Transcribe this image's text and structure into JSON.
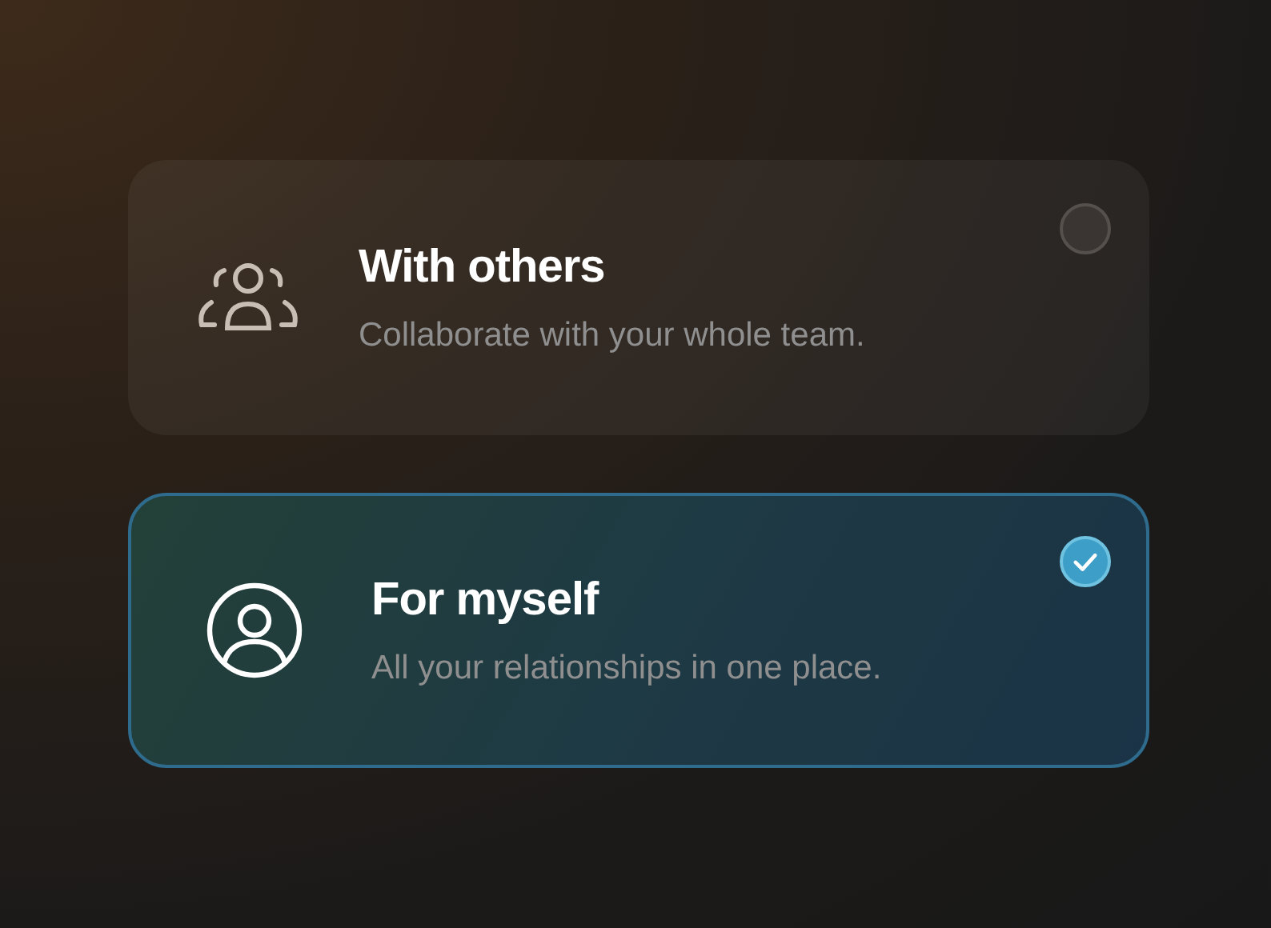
{
  "options": [
    {
      "kind": "group",
      "title": "With others",
      "description": "Collaborate with your whole team.",
      "selected": false
    },
    {
      "kind": "person",
      "title": "For myself",
      "description": "All your relationships in one place.",
      "selected": true
    }
  ]
}
